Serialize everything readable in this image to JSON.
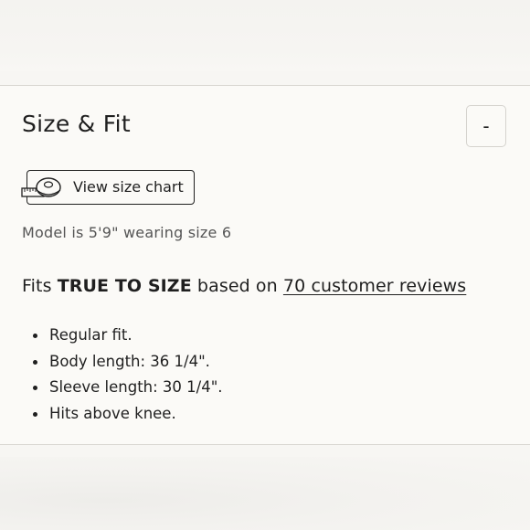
{
  "section": {
    "title": "Size & Fit",
    "toggle_label": "-"
  },
  "size_chart": {
    "label": "View size chart",
    "icon": "tape-measure-icon"
  },
  "model_info": "Model is 5'9\" wearing size 6",
  "fit": {
    "prefix": "Fits",
    "emphasis": "TRUE TO SIZE",
    "middle": "based on",
    "reviews_link": "70 customer reviews"
  },
  "details": [
    "Regular fit.",
    "Body length: 36 1/4\".",
    "Sleeve length: 30 1/4\".",
    "Hits above knee."
  ]
}
